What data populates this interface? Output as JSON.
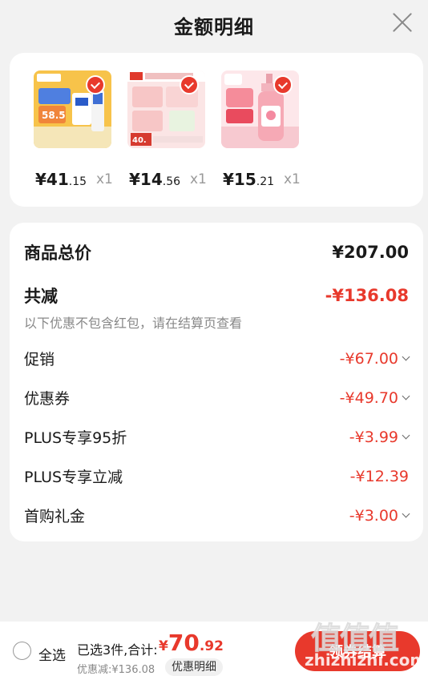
{
  "header": {
    "title": "金额明细"
  },
  "products": [
    {
      "price_int": "¥41",
      "price_dec": ".15",
      "qty": "x1",
      "image": "product-gift-box-image"
    },
    {
      "price_int": "¥14",
      "price_dec": ".56",
      "qty": "x1",
      "image": "product-laundry-pods-image"
    },
    {
      "price_int": "¥15",
      "price_dec": ".21",
      "qty": "x1",
      "image": "product-pink-bottle-image"
    }
  ],
  "summary": {
    "total_label": "商品总价",
    "total_value": "¥207.00",
    "reduce_label": "共减",
    "reduce_value": "-¥136.08",
    "note": "以下优惠不包含红包，请在结算页查看",
    "items": [
      {
        "label": "促销",
        "value": "-¥67.00",
        "expandable": true
      },
      {
        "label": "优惠券",
        "value": "-¥49.70",
        "expandable": true
      },
      {
        "label": "PLUS专享95折",
        "value": "-¥3.99",
        "expandable": true
      },
      {
        "label": "PLUS专享立减",
        "value": "-¥12.39",
        "expandable": false
      },
      {
        "label": "首购礼金",
        "value": "-¥3.00",
        "expandable": true
      }
    ]
  },
  "footer": {
    "select_all": "全选",
    "selected_text": "已选3件,合计:",
    "total_cur": "¥",
    "total_int": "70",
    "total_dec": ".92",
    "discount_text": "优惠减:¥136.08",
    "detail_button": "优惠明细",
    "checkout_button": "领券结算"
  },
  "watermark": {
    "glyphs": "值值值",
    "text": "zhizhizhi.com"
  },
  "colors": {
    "accent": "#e8392c",
    "background": "#f2f2f2"
  }
}
